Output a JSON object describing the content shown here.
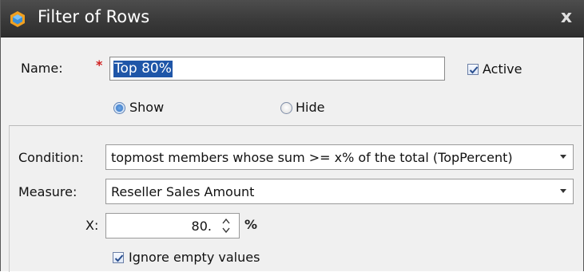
{
  "dialog": {
    "title": "Filter of Rows",
    "close_glyph": "x",
    "icon": "app-cube-icon"
  },
  "name_field": {
    "label": "Name:",
    "required_mark": "*",
    "value": "Top 80%"
  },
  "active_checkbox": {
    "label": "Active",
    "checked": true
  },
  "visibility": {
    "options": [
      {
        "label": "Show",
        "selected": true
      },
      {
        "label": "Hide",
        "selected": false
      }
    ]
  },
  "condition": {
    "label": "Condition:",
    "value": "topmost members whose sum >= x% of the total (TopPercent)"
  },
  "measure": {
    "label": "Measure:",
    "value": "Reseller Sales Amount"
  },
  "x_param": {
    "label": "X:",
    "value": "80.",
    "unit": "%"
  },
  "ignore_empty": {
    "label": "Ignore empty values",
    "checked": true
  },
  "colors": {
    "titlebar": "#3a3a3a",
    "selection": "#1f56a8",
    "required": "#d02020"
  }
}
